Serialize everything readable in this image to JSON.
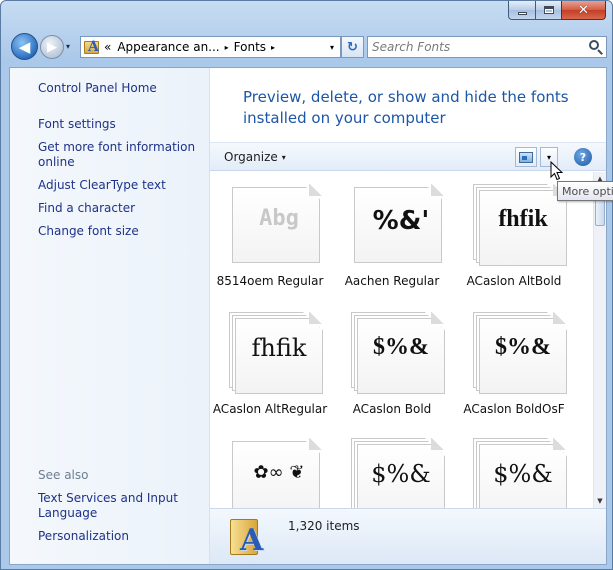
{
  "window": {
    "minimize_label": "–",
    "close_label": "✕"
  },
  "nav": {
    "back_glyph": "◀",
    "forward_glyph": "▶",
    "history_glyph": "▾",
    "refresh_glyph": "↻"
  },
  "address": {
    "overflow": "«",
    "crumbs": [
      "Appearance an...",
      "Fonts"
    ],
    "separator": "▸",
    "dropdown_glyph": "▾"
  },
  "search": {
    "placeholder": "Search Fonts"
  },
  "sidebar": {
    "control_panel_home": "Control Panel Home",
    "links": [
      "Font settings",
      "Get more font information online",
      "Adjust ClearType text",
      "Find a character",
      "Change font size"
    ],
    "see_also_label": "See also",
    "see_also": [
      "Text Services and Input Language",
      "Personalization"
    ]
  },
  "main": {
    "heading": "Preview, delete, or show and hide the fonts installed on your computer"
  },
  "toolbar": {
    "organize_label": "Organize",
    "caret": "▾",
    "view_dropdown_glyph": "▾",
    "help_label": "?"
  },
  "fonts": [
    {
      "name": "8514oem Regular",
      "sample": "Abg",
      "style": "light",
      "stack": 1
    },
    {
      "name": "Aachen Regular",
      "sample": "%&'",
      "style": "heavy",
      "stack": 1
    },
    {
      "name": "ACaslon AltBold",
      "sample": "fhfik",
      "style": "serifb",
      "stack": 3
    },
    {
      "name": "ACaslon AltRegular",
      "sample": "fhfik",
      "style": "serif",
      "stack": 3
    },
    {
      "name": "ACaslon Bold",
      "sample": "$%&",
      "style": "serifb",
      "stack": 3
    },
    {
      "name": "ACaslon BoldOsF",
      "sample": "$%&",
      "style": "serifb",
      "stack": 3
    },
    {
      "name": "",
      "sample": "✿∞ ❦",
      "style": "orn",
      "stack": 1
    },
    {
      "name": "",
      "sample": "$%&",
      "style": "serif",
      "stack": 3
    },
    {
      "name": "",
      "sample": "$%&",
      "style": "serif",
      "stack": 3
    }
  ],
  "scrollbar": {
    "up": "▲",
    "down": "▼"
  },
  "details": {
    "item_count": "1,320 items"
  },
  "tooltip": {
    "text": "More opti"
  }
}
